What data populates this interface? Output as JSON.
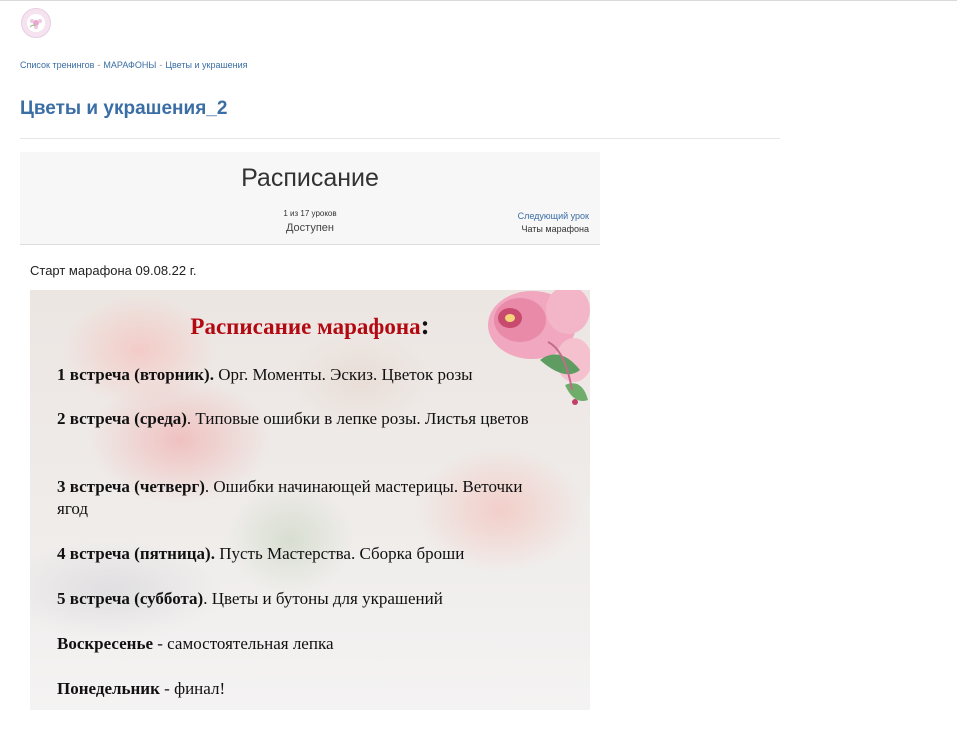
{
  "breadcrumb": {
    "items": [
      "Список тренингов",
      "МАРАФОНЫ",
      "Цветы и украшения"
    ],
    "separator": "-"
  },
  "page": {
    "title": "Цветы и украшения_2"
  },
  "lesson": {
    "title": "Расписание",
    "progress": "1 из 17 уроков",
    "status": "Доступен",
    "next_link": "Следующий урок",
    "chats_link": "Чаты марафона"
  },
  "content": {
    "start_text": "Старт марафона 09.08.22 г.",
    "schedule_heading": "Расписание марафона",
    "schedule_heading_suffix": ":",
    "items": [
      {
        "bold": "1 встреча (вторник).",
        "text": " Орг. Моменты. Эскиз. Цветок розы"
      },
      {
        "bold": "2 встреча (среда)",
        "text": ". Типовые ошибки в лепке розы. Листья цветов"
      },
      {
        "bold": "3 встреча (четверг)",
        "text": ". Ошибки начинающей мастерицы. Веточки ягод"
      },
      {
        "bold": "4 встреча (пятница).",
        "text": " Пусть Мастерства. Сборка броши"
      },
      {
        "bold": "5 встреча (суббота)",
        "text": ". Цветы и бутоны для украшений"
      },
      {
        "bold": "Воскресенье",
        "text": " - самостоятельная лепка"
      },
      {
        "bold": "Понедельник",
        "text": " - финал!"
      }
    ]
  },
  "colors": {
    "link": "#3a6ea5",
    "heading_red": "#b30a12"
  }
}
